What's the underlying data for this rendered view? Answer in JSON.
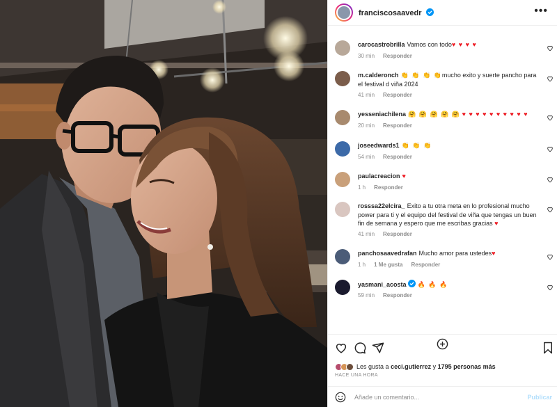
{
  "post": {
    "author": "franciscosaavedr",
    "more_label": "•••"
  },
  "comments": [
    {
      "user": "carocastrobrilla",
      "text": "Vamos con todo",
      "hearts": "♥ ♥ ♥ ♥",
      "emoji": "",
      "time": "30 min",
      "likes": "",
      "reply": "Responder"
    },
    {
      "user": "m.calderonch",
      "text": "mucho exito y suerte pancho para el festival d viña 2024",
      "hearts": "",
      "emoji": "👏 👏 👏 👏",
      "time": "41 min",
      "likes": "",
      "reply": "Responder"
    },
    {
      "user": "yesseniachilena",
      "text": "",
      "hearts": "♥ ♥ ♥ ♥ ♥ ♥ ♥ ♥ ♥ ♥",
      "emoji": "🤗 🤗 🤗 🤗 🤗",
      "time": "20 min",
      "likes": "",
      "reply": "Responder"
    },
    {
      "user": "joseedwards1",
      "text": "",
      "hearts": "",
      "emoji": "👏 👏 👏",
      "time": "54 min",
      "likes": "",
      "reply": "Responder"
    },
    {
      "user": "paulacreacion",
      "text": "",
      "hearts": "♥",
      "emoji": "",
      "time": "1 h",
      "likes": "",
      "reply": "Responder"
    },
    {
      "user": "rosssa22elcira_",
      "text": "Exito a tu otra meta en lo profesional mucho power para ti y el equipo del festival de viña que tengas un buen fin de semana y espero que me escribas gracias",
      "hearts": "♥",
      "emoji": "",
      "time": "41 min",
      "likes": "",
      "reply": "Responder"
    },
    {
      "user": "panchosaavedrafan",
      "text": "Mucho amor para ustedes",
      "hearts": "♥",
      "emoji": "",
      "time": "1 h",
      "likes": "1 Me gusta",
      "reply": "Responder"
    },
    {
      "user": "yasmani_acosta",
      "text": "",
      "hearts": "",
      "emoji": "🔥 🔥 🔥",
      "time": "59 min",
      "likes": "",
      "reply": "Responder"
    }
  ],
  "likes": {
    "prefix": "Les gusta a",
    "user": "ceci.gutierrez",
    "middle": "y",
    "count": "1795 personas más"
  },
  "timestamp": "HACE UNA HORA",
  "add_comment": {
    "placeholder": "Añade un comentario...",
    "publish": "Publicar"
  },
  "icons": {
    "like": "heart-icon",
    "comment": "comment-icon",
    "share": "share-icon",
    "save": "bookmark-icon",
    "more": "more-icon",
    "emoji": "emoji-icon",
    "load_more": "plus-circle-icon"
  },
  "colors": {
    "heart": "#ed1c24",
    "verified": "#0095f6",
    "publish": "#b2dffc",
    "muted": "#8e8e8e"
  }
}
